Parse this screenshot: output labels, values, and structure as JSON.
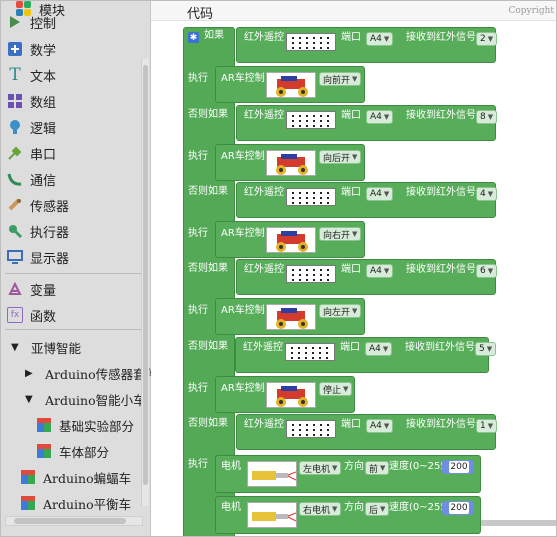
{
  "toolbox": {
    "header": "模块",
    "categories": [
      {
        "label": "控制",
        "icon": "control-icon"
      },
      {
        "label": "数学",
        "icon": "math-icon"
      },
      {
        "label": "文本",
        "icon": "text-icon"
      },
      {
        "label": "数组",
        "icon": "array-icon"
      },
      {
        "label": "逻辑",
        "icon": "logic-icon"
      },
      {
        "label": "串口",
        "icon": "serial-icon"
      },
      {
        "label": "通信",
        "icon": "communication-icon"
      },
      {
        "label": "传感器",
        "icon": "sensor-icon"
      },
      {
        "label": "执行器",
        "icon": "actuator-icon"
      },
      {
        "label": "显示器",
        "icon": "display-icon"
      },
      {
        "label": "变量",
        "icon": "variable-icon"
      },
      {
        "label": "函数",
        "icon": "function-icon"
      }
    ],
    "tree": {
      "root": "亚博智能",
      "sensor_kit": "Arduino传感器套件",
      "smart_car": "Arduino智能小车",
      "basic": "基础实验部分",
      "body": "车体部分",
      "bat_car": "Arduino蝙蝠车",
      "balance_car": "Arduino平衡车"
    }
  },
  "workspace": {
    "tab_label": "代码",
    "copyright": "Copyright",
    "kw_if": "如果",
    "kw_else_if": "否则如果",
    "kw_do": "执行",
    "ir_label": "红外遥控",
    "port_label": "端口",
    "recv_label": "接收到红外信号",
    "car_label": "AR车控制",
    "motor_label": "电机",
    "dir_label": "方向",
    "speed_label": "速度(0~255)",
    "conditions": [
      {
        "port": "A4",
        "signal": "2",
        "action": "向前开"
      },
      {
        "port": "A4",
        "signal": "8",
        "action": "向后开"
      },
      {
        "port": "A4",
        "signal": "4",
        "action": "向右开"
      },
      {
        "port": "A4",
        "signal": "6",
        "action": "向左开"
      },
      {
        "port": "A4",
        "signal": "5",
        "action": "停止"
      },
      {
        "port": "A4",
        "signal": "1",
        "action": ""
      }
    ],
    "motors": [
      {
        "motor": "左电机",
        "direction": "前",
        "speed": "200"
      },
      {
        "motor": "右电机",
        "direction": "后",
        "speed": "200"
      }
    ]
  },
  "colors": {
    "block_green": "#58ad5b",
    "number_blue": "#6f8ee0",
    "toolbox_bg": "#dddddd"
  }
}
